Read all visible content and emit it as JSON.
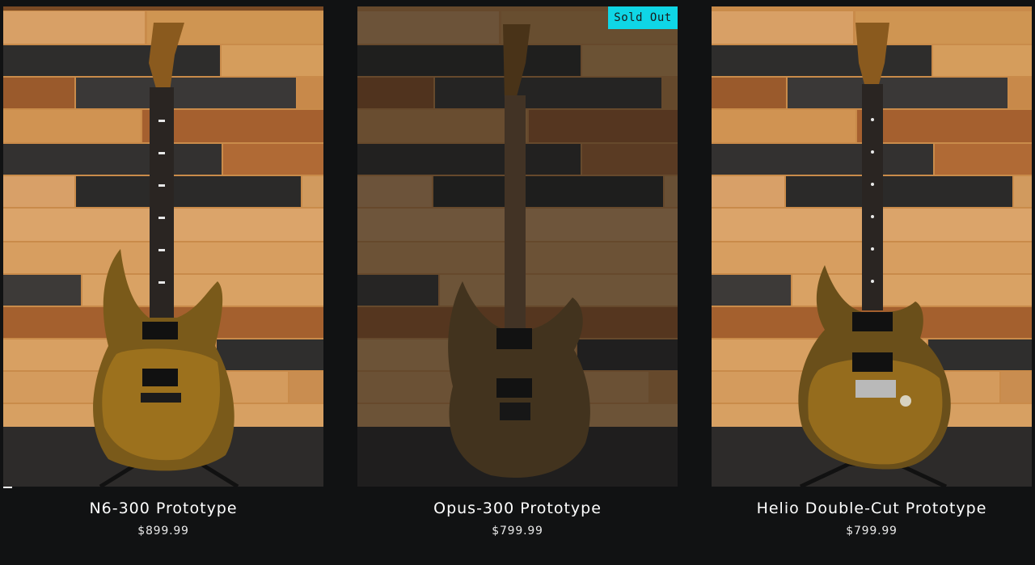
{
  "products": [
    {
      "name": "N6-300 Prototype",
      "price": "$899.99",
      "sold_out": false
    },
    {
      "name": "Opus-300 Prototype",
      "price": "$799.99",
      "sold_out": true,
      "badge": "Sold Out"
    },
    {
      "name": "Helio Double-Cut Prototype",
      "price": "$799.99",
      "sold_out": false
    }
  ],
  "colors": {
    "background": "#111213",
    "badge": "#0fd6e6",
    "text": "#ffffff"
  }
}
